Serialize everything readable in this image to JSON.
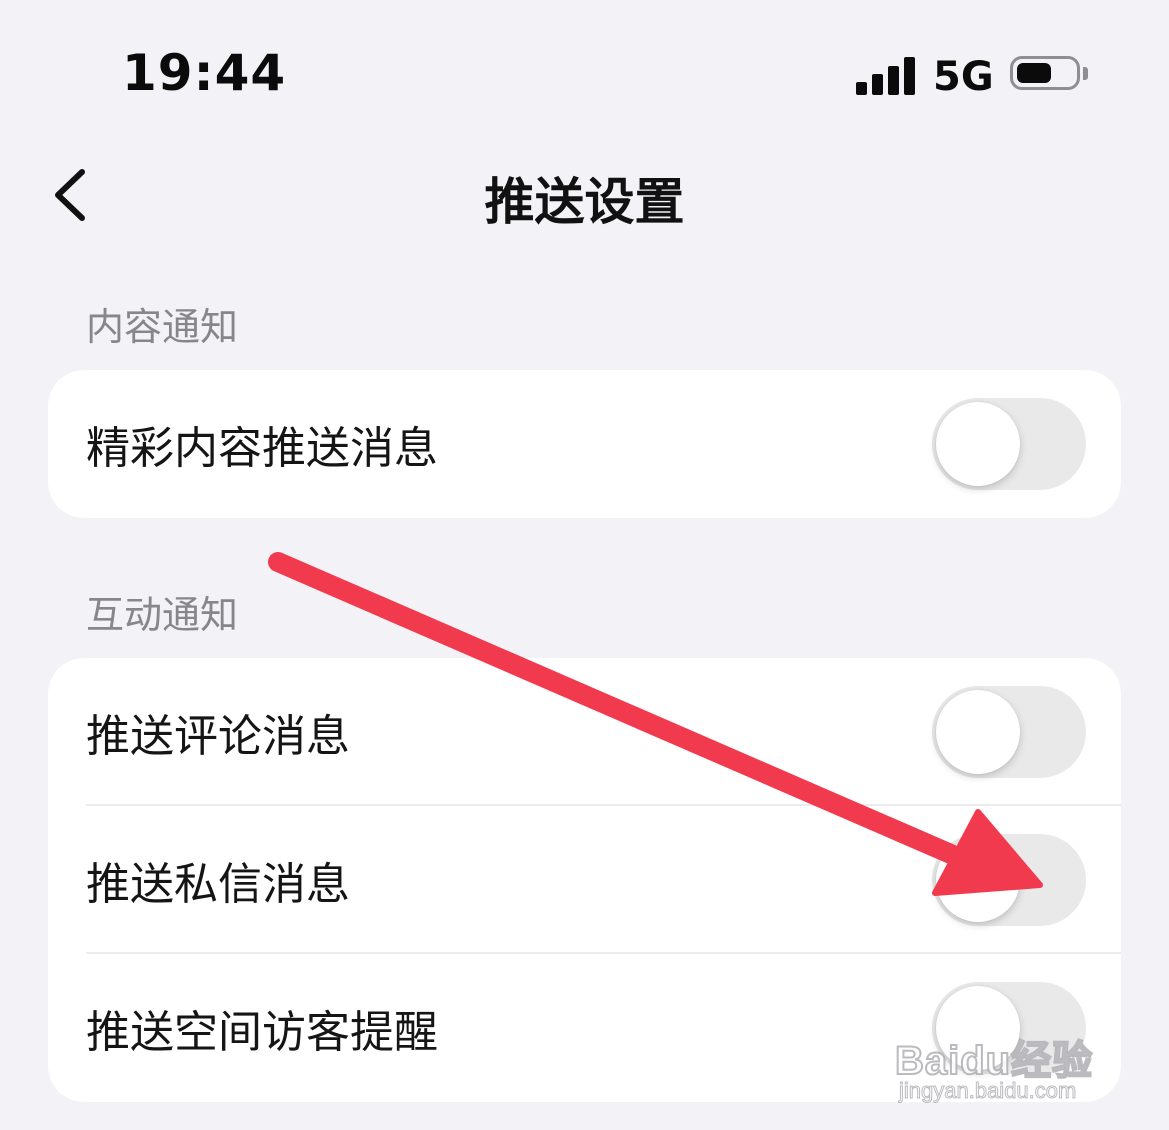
{
  "status_bar": {
    "time": "19:44",
    "network": "5G",
    "signal_bars": 4,
    "battery_level": 0.6
  },
  "header": {
    "title": "推送设置",
    "back_icon": "chevron-left-icon"
  },
  "sections": [
    {
      "label": "内容通知",
      "items": [
        {
          "label": "精彩内容推送消息",
          "enabled": false
        }
      ]
    },
    {
      "label": "互动通知",
      "items": [
        {
          "label": "推送评论消息",
          "enabled": false
        },
        {
          "label": "推送私信消息",
          "enabled": false
        },
        {
          "label": "推送空间访客提醒",
          "enabled": false
        }
      ]
    }
  ],
  "annotation": {
    "type": "arrow",
    "color": "#f23a4e",
    "target": "推送私信消息 toggle"
  },
  "watermark": {
    "logo": "Baidu经验",
    "url": "jingyan.baidu.com"
  }
}
